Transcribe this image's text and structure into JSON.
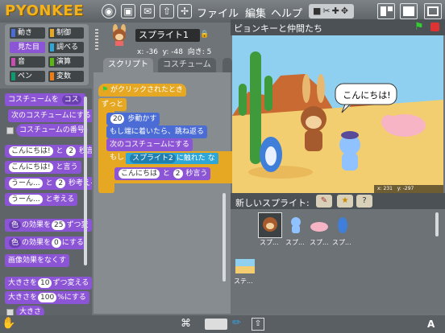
{
  "app": {
    "logo": "PYONKEE"
  },
  "menu": {
    "file": "ファイル",
    "edit": "編集",
    "help": "ヘルプ"
  },
  "categories": [
    {
      "label": "動き",
      "color": "#4a6cd4"
    },
    {
      "label": "制御",
      "color": "#e6a822"
    },
    {
      "label": "見た目",
      "color": "#8b55d6",
      "selected": true
    },
    {
      "label": "調べる",
      "color": "#2ea6d8"
    },
    {
      "label": "音",
      "color": "#c84fb0"
    },
    {
      "label": "演算",
      "color": "#5cb712"
    },
    {
      "label": "ペン",
      "color": "#0e9a6c"
    },
    {
      "label": "変数",
      "color": "#ee7d16"
    }
  ],
  "palette": {
    "b1": "コスチュームを",
    "b1b": "コス",
    "b2": "次のコスチュームにする",
    "b3": "コスチュームの番号",
    "say1_text": "こんにちは!",
    "say1_mid": "と",
    "say1_num": "2",
    "say1_end": "秒言う",
    "say2_text": "こんにちは!",
    "say2_end": "と言う",
    "think1_text": "うーん...",
    "think1_mid": "と",
    "think1_num": "2",
    "think1_end": "秒考える",
    "think2_text": "うーん...",
    "think2_end": "と考える",
    "eff1_pre": "色",
    "eff1_mid": "の効果を",
    "eff1_num": "25",
    "eff1_end": "ずつ変",
    "eff2_pre": "色",
    "eff2_mid": "の効果を",
    "eff2_num": "0",
    "eff2_end": "にする",
    "clear": "画像効果をなくす",
    "size1_pre": "大きさを",
    "size1_num": "10",
    "size1_end": "ずつ変える",
    "size2_pre": "大きさを",
    "size2_num": "100",
    "size2_end": "%にする",
    "size3": "大きさ"
  },
  "sprite": {
    "name": "スプライト1",
    "x_label": "x:",
    "x": "-36",
    "y_label": "y:",
    "y": "-48",
    "dir_label": "向き:",
    "dir": "5"
  },
  "tabs": {
    "script": "スクリプト",
    "costume": "コスチューム"
  },
  "script": {
    "hat": "がクリックされたとき",
    "forever": "ずっと",
    "move_num": "20",
    "move_text": "歩動かす",
    "bounce": "もし端に着いたら、跳ね返る",
    "next_costume": "次のコスチュームにする",
    "if": "もし",
    "touching_target": "スプライト2",
    "touching_text": "に触れた",
    "touching_q": "な",
    "say_text": "こんにちは",
    "say_mid": "と",
    "say_num": "2",
    "say_end": "秒言う"
  },
  "stage": {
    "title": "ピョンキーと仲間たち",
    "speech": "こんにちは!",
    "mouse_x_label": "x:",
    "mouse_x": "231",
    "mouse_y_label": "y:",
    "mouse_y": "-297"
  },
  "new_sprite": {
    "label": "新しいスプライト:"
  },
  "sprites": [
    {
      "label": "スプ..."
    },
    {
      "label": "スプ..."
    },
    {
      "label": "スプ..."
    },
    {
      "label": "スプ..."
    }
  ],
  "stage_thumb": {
    "label": "ステ..."
  },
  "colors": {
    "accent": "#f3b21c",
    "looks": "#8b55d6",
    "control": "#e6a822",
    "motion": "#4a6cd4",
    "sensing": "#2ea6d8"
  }
}
